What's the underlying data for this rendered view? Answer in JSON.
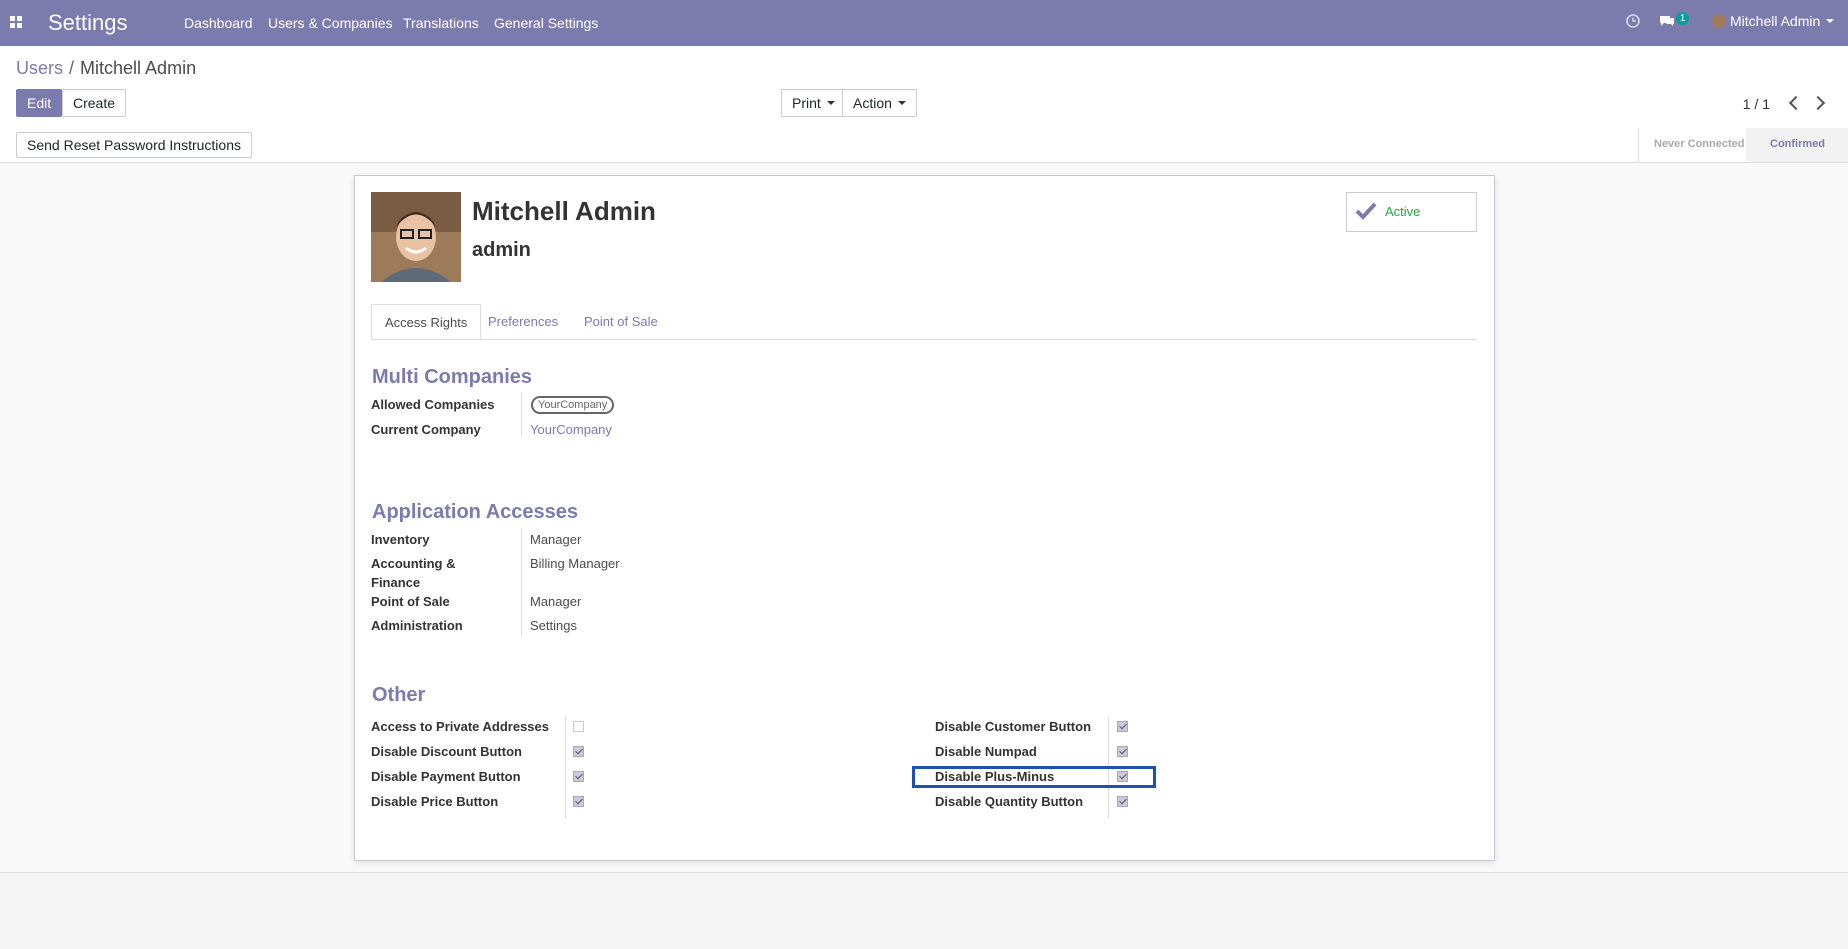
{
  "navbar": {
    "brand": "Settings",
    "menu": [
      "Dashboard",
      "Users & Companies",
      "Translations",
      "General Settings"
    ],
    "messages_count": "1",
    "user": "Mitchell Admin"
  },
  "breadcrumb": {
    "parent": "Users",
    "sep": "/",
    "current": "Mitchell Admin"
  },
  "toolbar": {
    "edit": "Edit",
    "create": "Create",
    "print": "Print",
    "action": "Action",
    "pager": "1 / 1"
  },
  "statusbar": {
    "reset_button": "Send Reset Password Instructions",
    "stages": [
      "Never Connected",
      "Confirmed"
    ]
  },
  "user": {
    "name": "Mitchell Admin",
    "login": "admin",
    "active_label": "Active"
  },
  "tabs": [
    "Access Rights",
    "Preferences",
    "Point of Sale"
  ],
  "multi_companies": {
    "title": "Multi Companies",
    "allowed_label": "Allowed Companies",
    "allowed_value": "YourCompany",
    "current_label": "Current Company",
    "current_value": "YourCompany"
  },
  "app_access": {
    "title": "Application Accesses",
    "rows": [
      {
        "label": "Inventory",
        "value": "Manager"
      },
      {
        "label": "Accounting &",
        "label2": "Finance",
        "value": "Billing Manager"
      },
      {
        "label": "Point of Sale",
        "value": "Manager"
      },
      {
        "label": "Administration",
        "value": "Settings"
      }
    ]
  },
  "other": {
    "title": "Other",
    "left": [
      {
        "label": "Access to Private Addresses",
        "checked": false
      },
      {
        "label": "Disable Discount Button",
        "checked": true
      },
      {
        "label": "Disable Payment Button",
        "checked": true
      },
      {
        "label": "Disable Price Button",
        "checked": true
      }
    ],
    "right": [
      {
        "label": "Disable Customer Button",
        "checked": true
      },
      {
        "label": "Disable Numpad",
        "checked": true
      },
      {
        "label": "Disable Plus-Minus",
        "checked": true
      },
      {
        "label": "Disable Quantity Button",
        "checked": true
      }
    ]
  }
}
